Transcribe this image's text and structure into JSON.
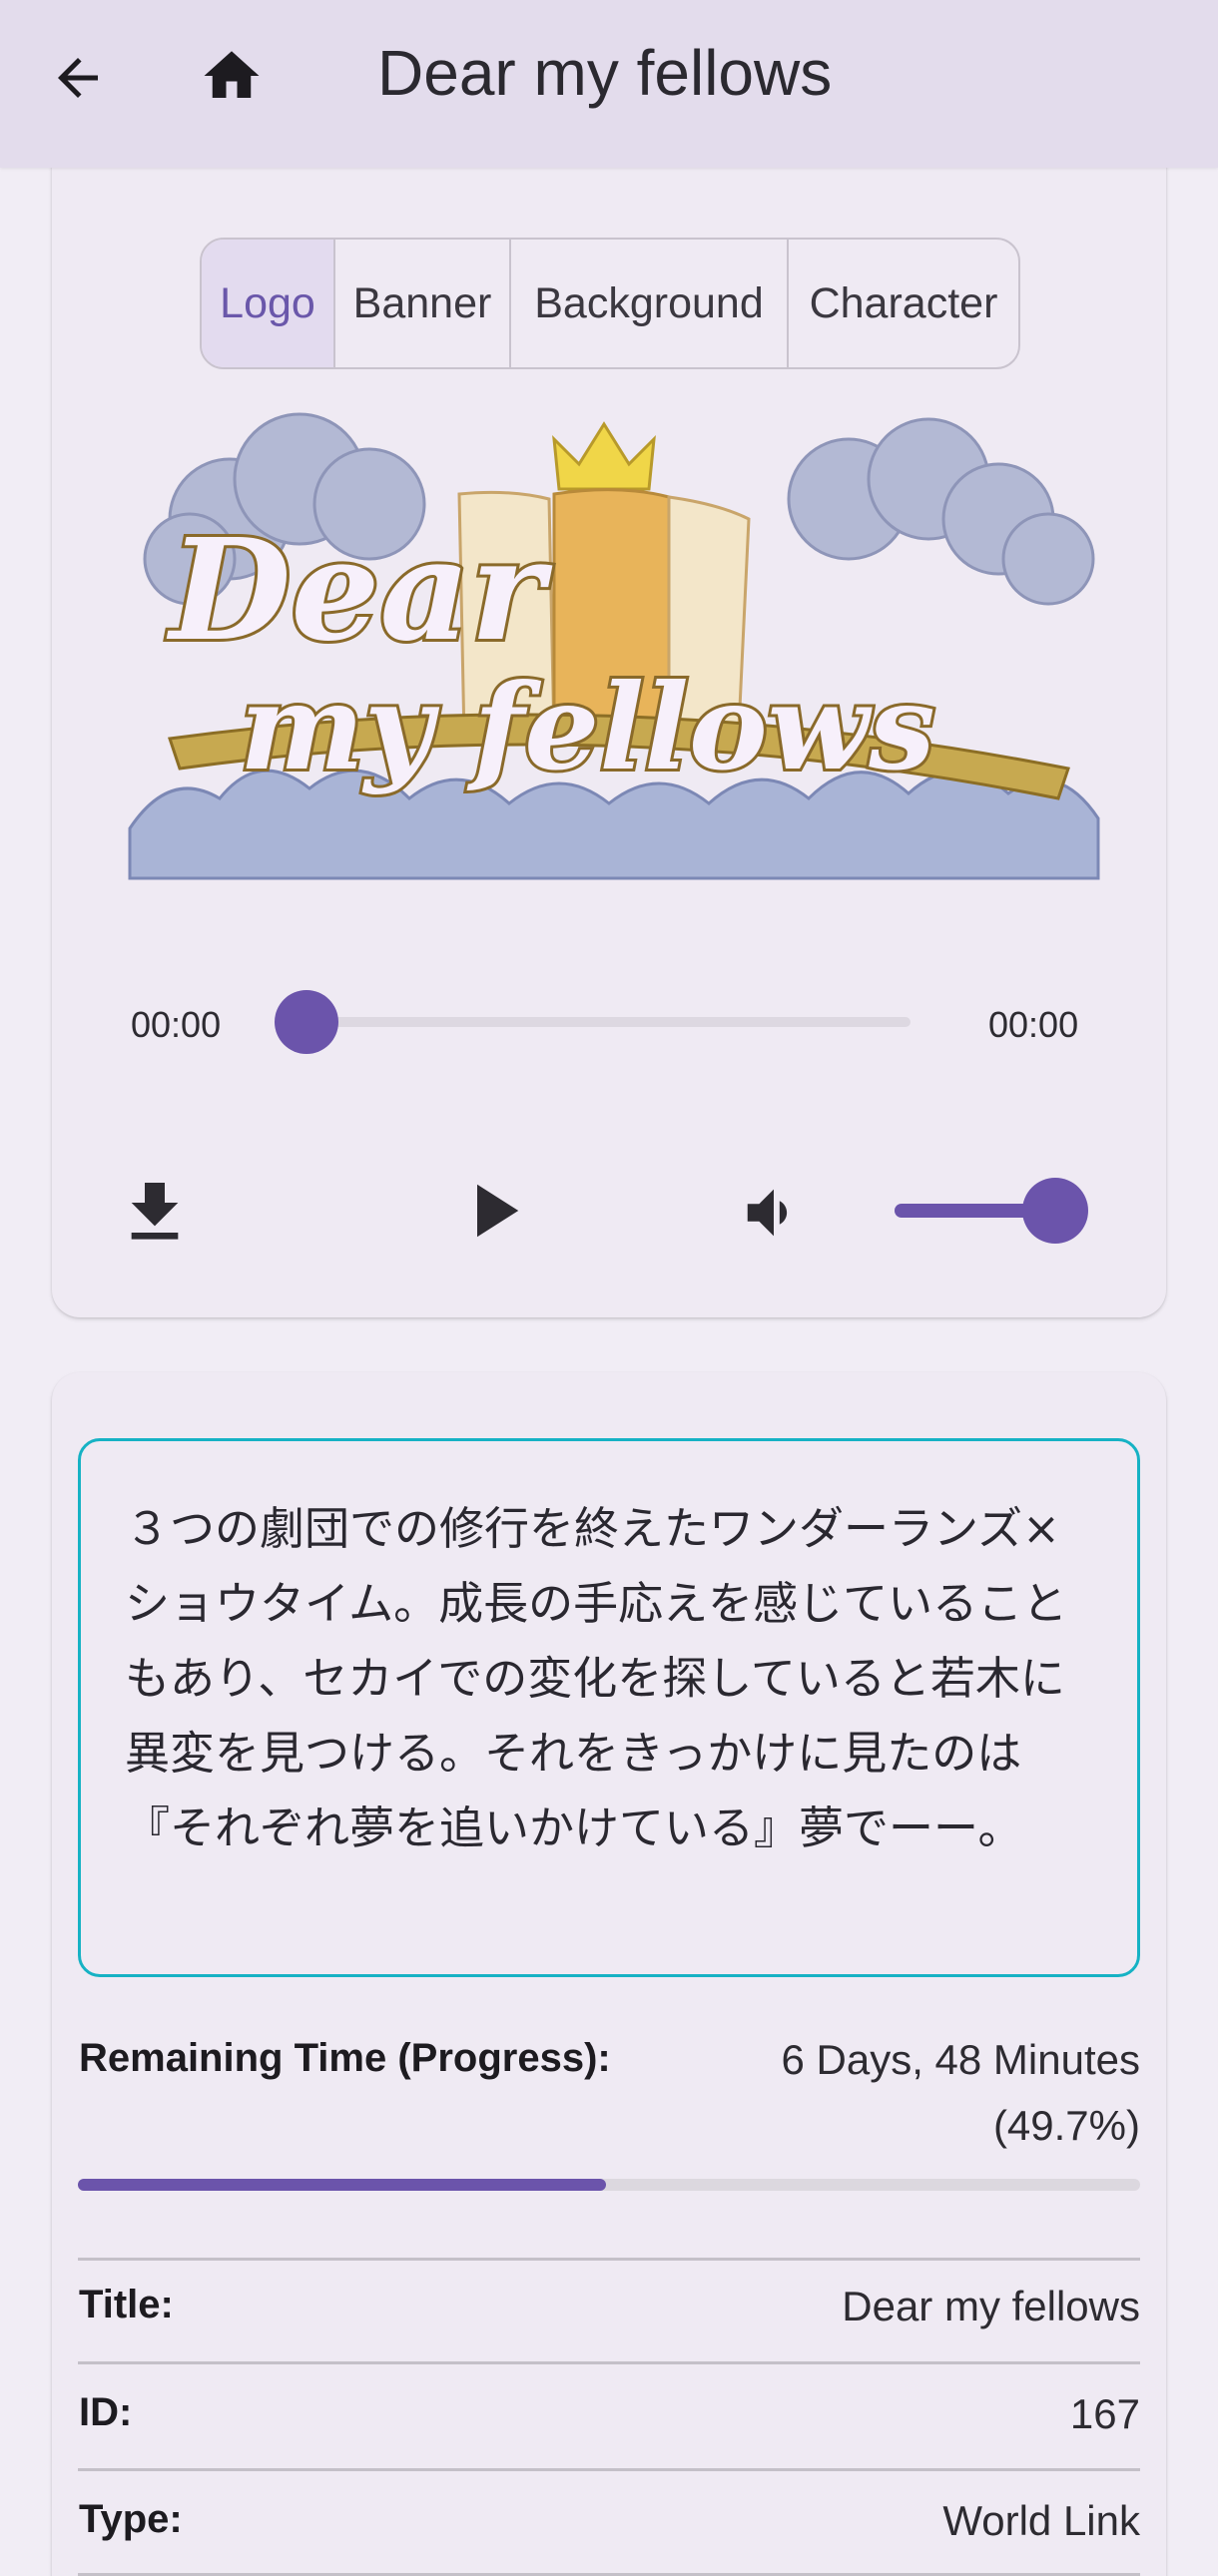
{
  "app_bar": {
    "title": "Dear my fellows",
    "back_icon": "arrow-back-icon",
    "home_icon": "home-icon"
  },
  "tabs": [
    {
      "label": "Logo",
      "active": true
    },
    {
      "label": "Banner",
      "active": false
    },
    {
      "label": "Background",
      "active": false
    },
    {
      "label": "Character",
      "active": false
    }
  ],
  "logo": {
    "line1": "Dear",
    "line2": "my fellows"
  },
  "audio": {
    "current_time": "00:00",
    "total_time": "00:00",
    "position_fraction": 0.0,
    "volume_fraction": 1.0,
    "download_icon": "download-icon",
    "play_icon": "play-icon",
    "volume_icon": "volume-icon"
  },
  "description": "３つの劇団での修行を終えたワンダーランズ×ショウタイム。成長の手応えを感じていることもあり、セカイでの変化を探していると若木に異変を見つける。それをきっかけに見たのは『それぞれ夢を追いかけている』夢でーー。",
  "remaining": {
    "label": "Remaining Time (Progress):",
    "value_line1": "6 Days, 48 Minutes",
    "value_line2": "(49.7%)",
    "progress_fraction": 0.497
  },
  "details": [
    {
      "label": "Title:",
      "value": "Dear my fellows"
    },
    {
      "label": "ID:",
      "value": "167"
    },
    {
      "label": "Type:",
      "value": "World Link"
    }
  ],
  "colors": {
    "accent": "#6b54ab",
    "outline_teal": "#16b2c4",
    "app_bar": "#e3dcec"
  }
}
